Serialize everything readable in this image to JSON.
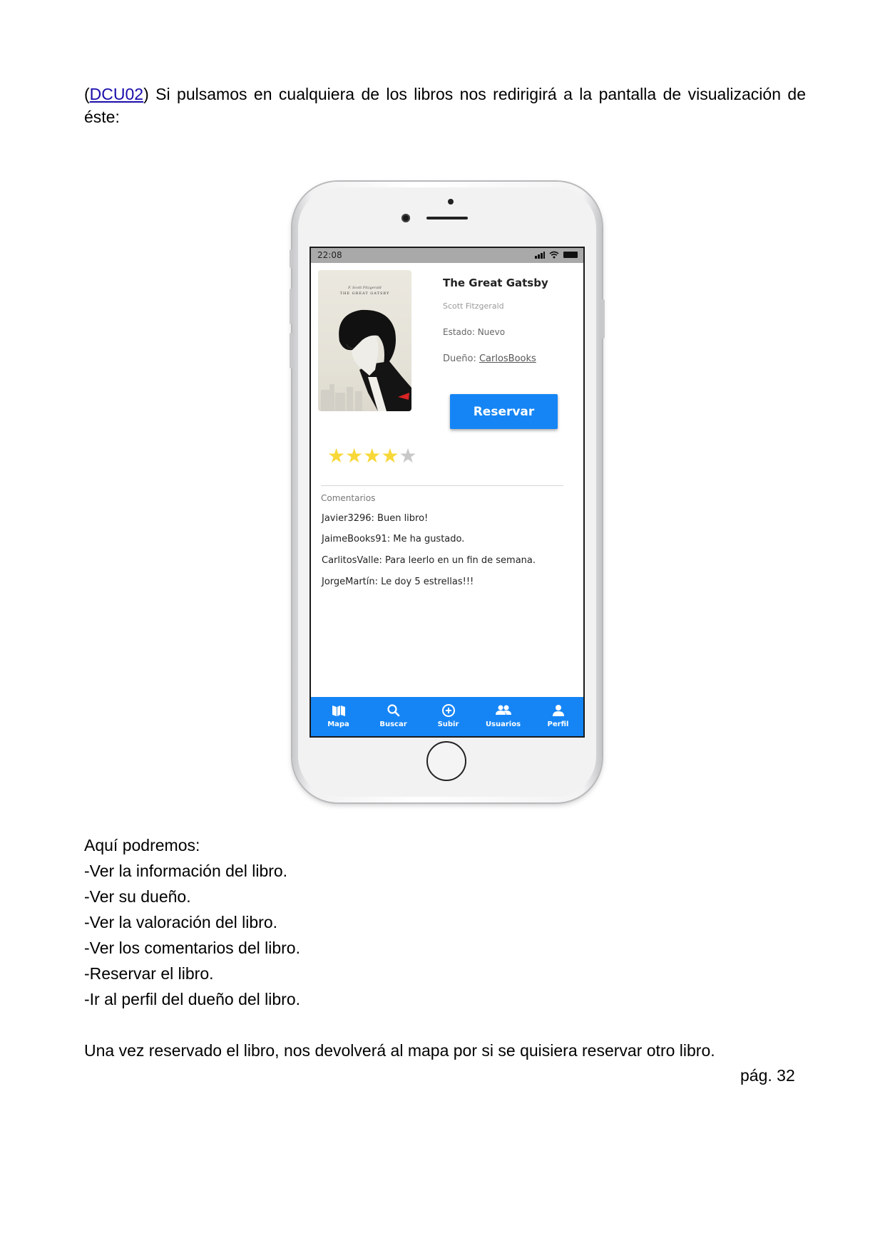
{
  "intro": {
    "open_paren": "(",
    "link": "DCU02",
    "text": ") Si pulsamos en cualquiera de los libros nos redirigirá a la pantalla de visualización de éste:"
  },
  "phone_screen": {
    "status": {
      "time": "22:08"
    },
    "book": {
      "title": "The Great Gatsby",
      "author": "Scott Fitzgerald",
      "estado": "Estado: Nuevo",
      "dueno_label": "Dueño: ",
      "dueno_link": "CarlosBooks",
      "cover_subtitle": "F. Scott Fitzgerald",
      "cover_title": "THE GREAT GATSBY"
    },
    "reserve_button": "Reservar",
    "rating": {
      "value": 4,
      "max": 5
    },
    "comments_label": "Comentarios",
    "comments": [
      "Javier3296: Buen libro!",
      "JaimeBooks91: Me ha gustado.",
      "CarlitosValle: Para leerlo en un fin de semana.",
      "JorgeMartín: Le doy 5 estrellas!!!"
    ],
    "tabs": [
      {
        "label": "Mapa",
        "icon": "map-icon"
      },
      {
        "label": "Buscar",
        "icon": "search-icon"
      },
      {
        "label": "Subir",
        "icon": "add-circle-icon"
      },
      {
        "label": "Usuarios",
        "icon": "users-icon"
      },
      {
        "label": "Perfil",
        "icon": "person-icon"
      }
    ],
    "colors": {
      "accent": "#1585f5",
      "star": "#f8d839",
      "status_bar": "#a9a9a9"
    }
  },
  "body": {
    "lines": [
      "Aquí podremos:",
      "-Ver la información del libro.",
      "-Ver su dueño.",
      "-Ver la valoración del libro.",
      "-Ver los comentarios del libro.",
      "-Reservar el libro.",
      "-Ir al perfil del dueño del libro."
    ],
    "closing": "Una vez reservado el libro, nos devolverá al mapa por si se quisiera reservar otro libro."
  },
  "footer": {
    "page": "pág. 32"
  }
}
